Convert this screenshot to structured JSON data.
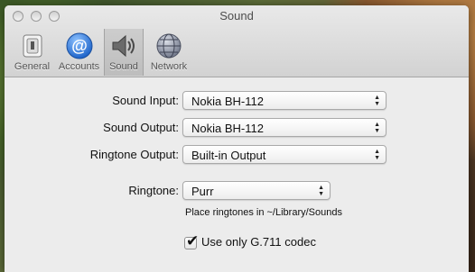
{
  "window": {
    "title": "Sound"
  },
  "toolbar": {
    "items": [
      {
        "label": "General",
        "icon": "switch-icon"
      },
      {
        "label": "Accounts",
        "icon": "at-sign-icon"
      },
      {
        "label": "Sound",
        "icon": "speaker-icon",
        "selected": true
      },
      {
        "label": "Network",
        "icon": "globe-network-icon"
      }
    ]
  },
  "sound": {
    "input": {
      "label": "Sound Input:",
      "value": "Nokia BH-112"
    },
    "output": {
      "label": "Sound Output:",
      "value": "Nokia BH-112"
    },
    "ringtone_output": {
      "label": "Ringtone Output:",
      "value": "Built-in Output"
    },
    "ringtone": {
      "label": "Ringtone:",
      "value": "Purr"
    },
    "hint": "Place ringtones in ~/Library/Sounds",
    "g711": {
      "label": "Use only G.711 codec",
      "checked": true
    }
  },
  "colors": {
    "accounts_blue": "#2f7be0",
    "selection": "#c4c4c4"
  }
}
